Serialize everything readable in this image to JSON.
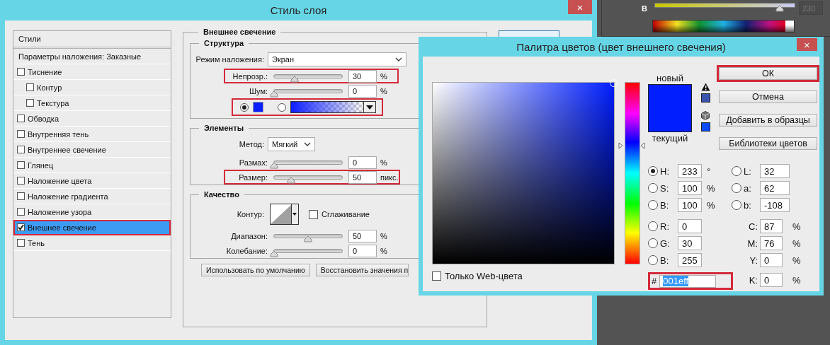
{
  "layer_style": {
    "title": "Стиль слоя",
    "close": "×",
    "styles_header": "Стили",
    "blending_options": "Параметры наложения: Заказные",
    "styles": [
      {
        "label": "Тиснение",
        "checked": false,
        "selected": false,
        "highlighted": false,
        "children": [
          {
            "label": "Контур",
            "checked": false,
            "selected": false,
            "highlighted": false
          },
          {
            "label": "Текстура",
            "checked": false,
            "selected": false,
            "highlighted": false
          }
        ]
      },
      {
        "label": "Обводка",
        "checked": false,
        "selected": false,
        "highlighted": false
      },
      {
        "label": "Внутренняя тень",
        "checked": false,
        "selected": false,
        "highlighted": false
      },
      {
        "label": "Внутреннее свечение",
        "checked": false,
        "selected": false,
        "highlighted": false
      },
      {
        "label": "Глянец",
        "checked": false,
        "selected": false,
        "highlighted": false
      },
      {
        "label": "Наложение цвета",
        "checked": false,
        "selected": false,
        "highlighted": false
      },
      {
        "label": "Наложение градиента",
        "checked": false,
        "selected": false,
        "highlighted": false
      },
      {
        "label": "Наложение узора",
        "checked": false,
        "selected": false,
        "highlighted": false
      },
      {
        "label": "Внешнее свечение",
        "checked": true,
        "selected": true,
        "highlighted": true
      },
      {
        "label": "Тень",
        "checked": false,
        "selected": false,
        "highlighted": false
      }
    ],
    "section_title": "Внешнее свечение",
    "structure": {
      "title": "Структура",
      "blend_mode_label": "Режим наложения:",
      "blend_mode": "Экран",
      "sliders": [
        {
          "label": "Непрозр.:",
          "level": 0.3,
          "value": "30",
          "unit": "%",
          "highlighted": true
        },
        {
          "label": "Шум:",
          "level": 0,
          "value": "0",
          "unit": "%",
          "highlighted": false
        }
      ],
      "fill": {
        "highlighted": true,
        "color": "#0b1eff",
        "options": [
          {
            "kind": "solid",
            "selected": true
          },
          {
            "kind": "gradient",
            "selected": false
          }
        ]
      }
    },
    "elements": {
      "title": "Элементы",
      "method_label": "Метод:",
      "method": "Мягкий",
      "sliders": [
        {
          "label": "Размах:",
          "level": 0,
          "value": "0",
          "unit": "%",
          "highlighted": false
        },
        {
          "label": "Размер:",
          "level": 0.25,
          "value": "50",
          "unit": "пикс.",
          "highlighted": true
        }
      ]
    },
    "quality": {
      "title": "Качество",
      "contour_label": "Контур:",
      "antialias": {
        "label": "Сглаживание",
        "checked": false
      },
      "sliders": [
        {
          "label": "Диапазон:",
          "level": 0.5,
          "value": "50",
          "unit": "%",
          "highlighted": false
        },
        {
          "label": "Колебание:",
          "level": 0,
          "value": "0",
          "unit": "%",
          "highlighted": false
        }
      ]
    },
    "buttons": [
      "Использовать по умолчанию",
      "Восстановить значения п"
    ]
  },
  "color_panel": {
    "label": "B",
    "level": 0.9,
    "value": "230"
  },
  "color_picker": {
    "title": "Палитра цветов (цвет внешнего свечения)",
    "close": "×",
    "new_label": "новый",
    "current_label": "текущий",
    "hue_slider": {
      "level": 0.65
    },
    "buttons": [
      {
        "label": "ОК",
        "highlighted": true
      },
      {
        "label": "Отмена",
        "highlighted": false
      },
      {
        "label": "Добавить в образцы",
        "highlighted": false
      },
      {
        "label": "Библиотеки цветов",
        "highlighted": false
      }
    ],
    "hsb": [
      {
        "label": "H:",
        "value": "233",
        "unit": "°",
        "selected": true
      },
      {
        "label": "S:",
        "value": "100",
        "unit": "%",
        "selected": false
      },
      {
        "label": "B:",
        "value": "100",
        "unit": "%",
        "selected": false
      }
    ],
    "rgb": [
      {
        "label": "R:",
        "value": "0",
        "selected": false
      },
      {
        "label": "G:",
        "value": "30",
        "selected": false
      },
      {
        "label": "B:",
        "value": "255",
        "selected": false
      }
    ],
    "lab": [
      {
        "label": "L:",
        "value": "32",
        "selected": false
      },
      {
        "label": "a:",
        "value": "62",
        "selected": false
      },
      {
        "label": "b:",
        "value": "-108",
        "selected": false
      }
    ],
    "cmyk": [
      {
        "label": "C:",
        "value": "87",
        "unit": "%"
      },
      {
        "label": "M:",
        "value": "76",
        "unit": "%"
      },
      {
        "label": "Y:",
        "value": "0",
        "unit": "%"
      },
      {
        "label": "K:",
        "value": "0",
        "unit": "%"
      }
    ],
    "hex": {
      "label": "#",
      "value": "001eff",
      "highlighted": true,
      "text_selected": true
    },
    "web_only": {
      "label": "Только Web-цвета",
      "checked": false
    }
  }
}
